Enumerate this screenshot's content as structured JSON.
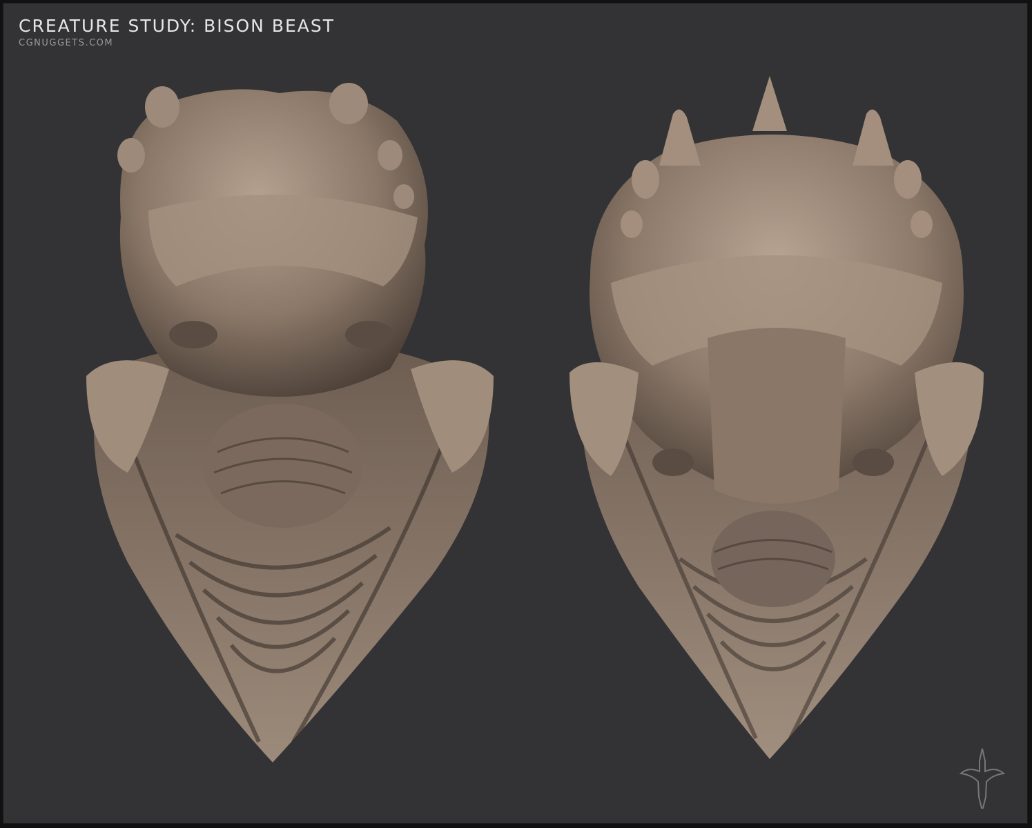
{
  "header": {
    "title": "Creature Study: Bison Beast",
    "subtitle": "CGNUGGETS.COM"
  },
  "renders": [
    {
      "name": "bison-beast-front-view",
      "view": "front"
    },
    {
      "name": "bison-beast-high-angle-view",
      "view": "top-front"
    }
  ],
  "logo": {
    "icon": "stylized-creature-silhouette-icon"
  },
  "colors": {
    "background": "#333335",
    "sculpt_light": "#a89584",
    "sculpt_mid": "#7b6a5d",
    "sculpt_dark": "#3b322c"
  }
}
